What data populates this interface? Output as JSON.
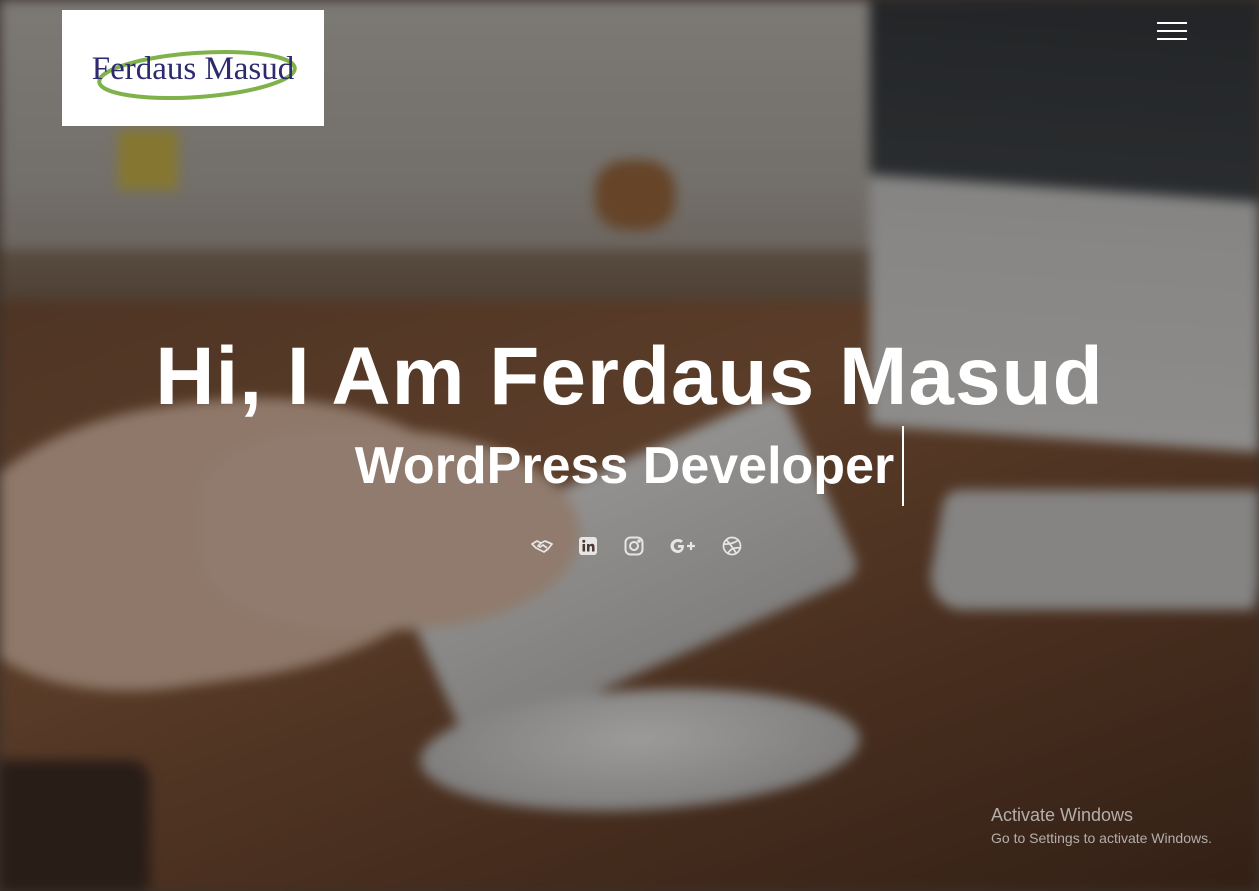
{
  "header": {
    "logo_text": "Ferdaus Masud",
    "menu_icon": "hamburger-menu-icon"
  },
  "hero": {
    "title": "Hi, I Am Ferdaus Masud",
    "subtitle": "WordPress Developer"
  },
  "social_links": [
    {
      "icon": "handshake-icon"
    },
    {
      "icon": "linkedin-icon"
    },
    {
      "icon": "instagram-icon"
    },
    {
      "icon": "google-plus-icon"
    },
    {
      "icon": "dribbble-icon"
    }
  ],
  "watermark": {
    "line1": "Activate Windows",
    "line2": "Go to Settings to activate Windows."
  },
  "colors": {
    "logo_text": "#2e2a6e",
    "logo_swoosh": "#7fb24a",
    "hero_text": "#ffffff"
  }
}
